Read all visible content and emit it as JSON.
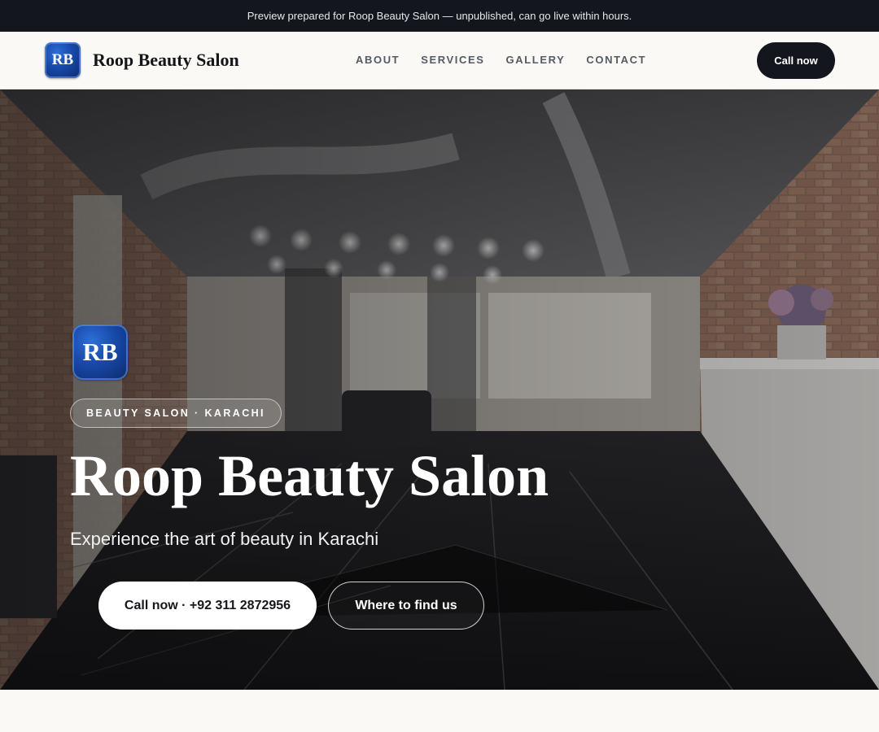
{
  "preview_bar": {
    "text": "Preview prepared for Roop Beauty Salon — unpublished, can go live within hours."
  },
  "header": {
    "logo_initials": "RB",
    "brand": "Roop Beauty Salon",
    "nav": [
      "ABOUT",
      "SERVICES",
      "GALLERY",
      "CONTACT"
    ],
    "cta": "Call now"
  },
  "hero": {
    "logo_initials": "RB",
    "tag": "BEAUTY SALON · KARACHI",
    "title": "Roop Beauty Salon",
    "subtitle": "Experience the art of beauty in Karachi",
    "primary_button": "Call now · +92 311 2872956",
    "secondary_button": "Where to find us",
    "background_image": "salon-interior-photo"
  }
}
